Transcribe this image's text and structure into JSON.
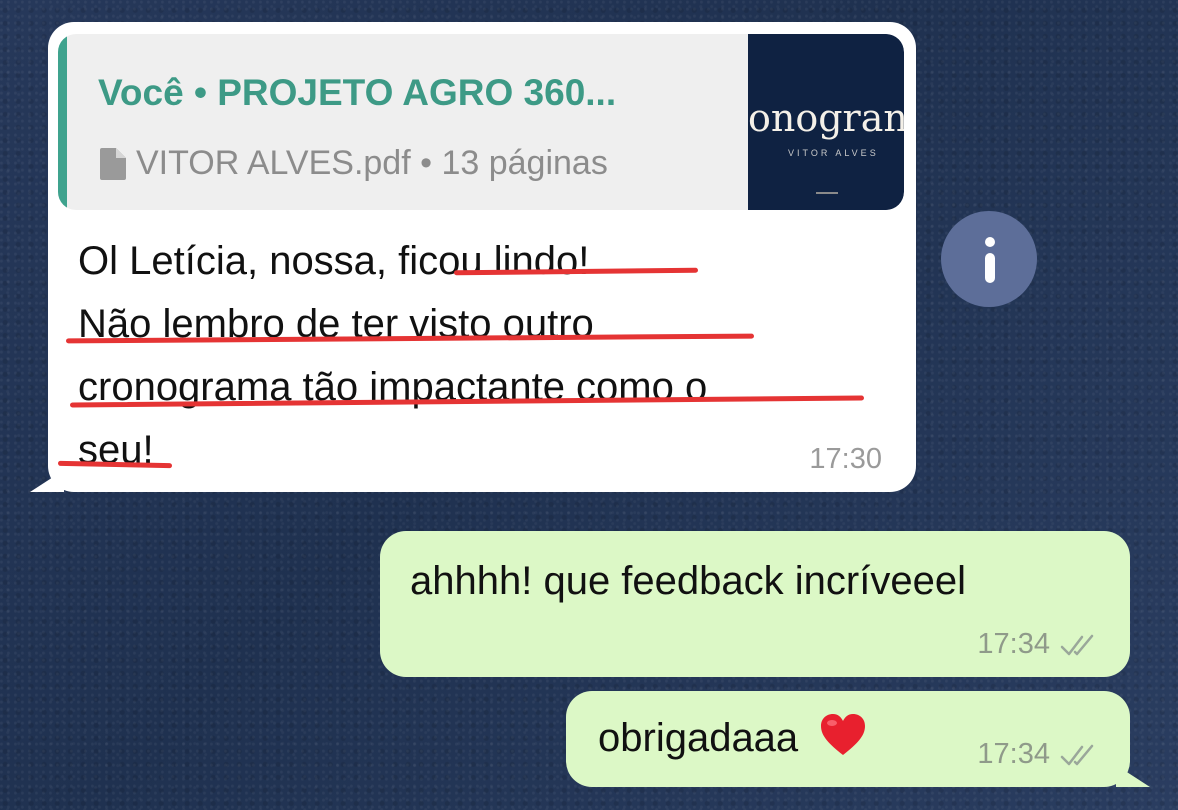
{
  "incoming_message": {
    "quote": {
      "title": "Você • PROJETO AGRO 360...",
      "file_icon": "document-icon",
      "file_info": "VITOR ALVES.pdf • 13 páginas",
      "thumbnail_title": "onogran",
      "thumbnail_subtitle": "VITOR ALVES"
    },
    "lines": [
      "Ol Letícia, nossa, ficou lindo!",
      "Não lembro de ter visto outro",
      "cronograma tão impactante como o",
      "seu!"
    ],
    "time": "17:30"
  },
  "info_button": {
    "icon": "info-icon"
  },
  "outgoing_messages": [
    {
      "text": "ahhhh! que feedback incríveeel",
      "time": "17:34",
      "status_icon": "double-check-icon"
    },
    {
      "text": "obrigadaaa",
      "emoji_icon": "red-heart-icon",
      "time": "17:34",
      "status_icon": "double-check-icon"
    }
  ],
  "colors": {
    "quote_accent": "#3d9a86",
    "outgoing_bubble": "#dcf8c6",
    "underline": "#e53434",
    "wallpaper": "#26385a"
  }
}
